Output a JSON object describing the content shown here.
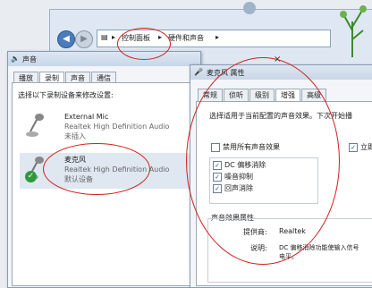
{
  "control_panel": {
    "breadcrumb_1": "控制面板",
    "breadcrumb_2": "硬件和声音",
    "separator": "▸"
  },
  "sound_dialog": {
    "title": "声音",
    "tabs": [
      "播放",
      "录制",
      "声音",
      "通信"
    ],
    "active_tab": 1,
    "instruction": "选择以下录制设备来修改设置:",
    "devices": [
      {
        "name": "External Mic",
        "driver": "Realtek High Definition Audio",
        "status": "未插入"
      },
      {
        "name": "麦克风",
        "driver": "Realtek High Definition Audio",
        "status": "默认设备"
      }
    ]
  },
  "props_dialog": {
    "title": "麦克风 属性",
    "close_label": "×",
    "tabs": [
      "常规",
      "侦听",
      "级别",
      "增强",
      "高级"
    ],
    "active_tab": 3,
    "description": "选择适用于当前配置的声音效果。下次开始播",
    "disable_all": {
      "label": "禁用所有声音效果",
      "checked": false
    },
    "immediate": {
      "label": "立即",
      "checked": true
    },
    "effects": [
      {
        "label": "DC 偏移消除",
        "checked": true
      },
      {
        "label": "噪音抑制",
        "checked": true
      },
      {
        "label": "回声消除",
        "checked": true
      }
    ],
    "properties_header": "声音效果属性",
    "provider_label": "提供商:",
    "provider_value": "Realtek",
    "explain_label": "说明:",
    "explain_line1": "DC 偏移消除功能使输入信号",
    "explain_line2": "电平。"
  },
  "colors": {
    "annotation": "#d0201c",
    "accent": "#1a4f9c"
  }
}
